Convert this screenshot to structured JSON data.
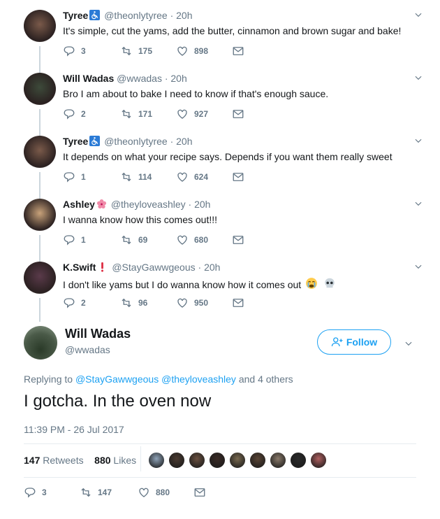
{
  "tweets": [
    {
      "name": "Tyree",
      "badge": "wheelchair-emoji",
      "handle": "@theonlytyree",
      "time": "· 20h",
      "text": "It's simple, cut the yams, add the butter, cinnamon and brown sugar and bake!",
      "replies": "3",
      "retweets": "175",
      "likes": "898",
      "avatar_color": "#7a5a4a"
    },
    {
      "name": "Will Wadas",
      "badge": "",
      "handle": "@wwadas",
      "time": "· 20h",
      "text": "Bro I am about to bake I need to know if that's enough sauce.",
      "replies": "2",
      "retweets": "171",
      "likes": "927",
      "avatar_color": "#3d4a3a"
    },
    {
      "name": "Tyree",
      "badge": "wheelchair-emoji",
      "handle": "@theonlytyree",
      "time": "· 20h",
      "text": "It depends on what your recipe says. Depends if you want them really sweet",
      "replies": "1",
      "retweets": "114",
      "likes": "624",
      "avatar_color": "#7a5a4a"
    },
    {
      "name": "Ashley",
      "badge": "hibiscus-emoji",
      "handle": "@theyloveashley",
      "time": "· 20h",
      "text": "I wanna know how this comes out!!!",
      "replies": "1",
      "retweets": "69",
      "likes": "680",
      "avatar_color": "#c8a27a"
    },
    {
      "name": "K.Swift",
      "badge": "exclamation-emoji",
      "handle": "@StayGawwgeous",
      "time": "· 20h",
      "text": "I don't like yams but I do wanna know how it comes out",
      "replies": "2",
      "retweets": "96",
      "likes": "950",
      "avatar_color": "#5a3a4a"
    }
  ],
  "main": {
    "name": "Will Wadas",
    "handle": "@wwadas",
    "follow_label": "Follow",
    "replying_prefix": "Replying to",
    "replying_users": [
      "@StayGawwgeous",
      "@theyloveashley"
    ],
    "replying_suffix": "and 4 others",
    "text": "I gotcha. In the oven now",
    "timestamp": "11:39 PM - 26 Jul 2017",
    "retweets_count": "147",
    "retweets_label": "Retweets",
    "likes_count": "880",
    "likes_label": "Likes",
    "replies": "3",
    "retweets": "147",
    "likes": "880"
  },
  "liker_colors": [
    "#8fa3b8",
    "#4a3a30",
    "#6a5040",
    "#3a2a25",
    "#7a6a50",
    "#5a4535",
    "#8a7a6a",
    "#2a2a2a",
    "#b06060"
  ],
  "colors": {
    "accent": "#1da1f2",
    "muted": "#657786",
    "thread": "#ccd6dd"
  }
}
